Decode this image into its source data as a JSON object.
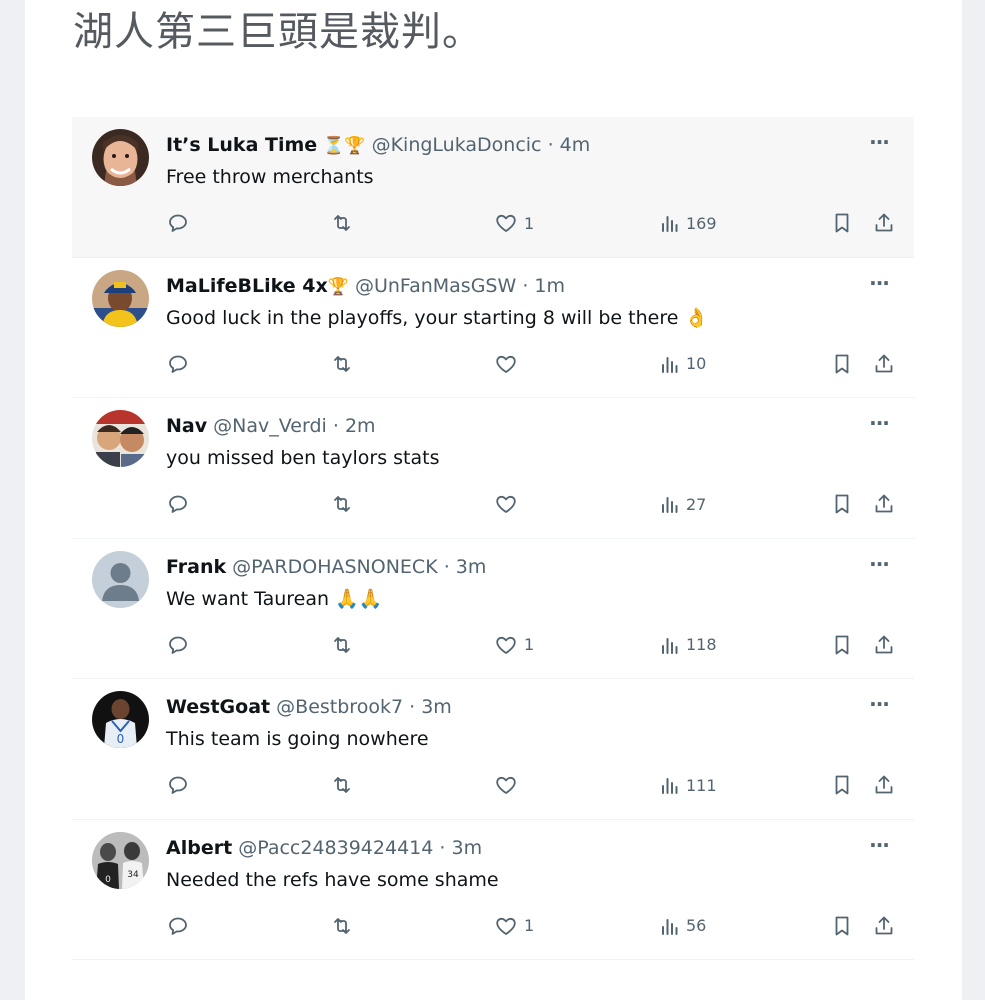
{
  "post": {
    "title": "湖人第三巨頭是裁判。"
  },
  "colors": {
    "icon_gray": "#536471",
    "text": "#0f1419",
    "highlight_bg": "#f7f7f7"
  },
  "tweets": [
    {
      "name": "It’s Luka Time",
      "badges": "⏳🏆",
      "handle": "@KingLukaDoncic",
      "sep": "·",
      "time": "4m",
      "text": "Free throw merchants",
      "likes": "1",
      "views": "169",
      "highlighted": true,
      "avatar": "smiling-man"
    },
    {
      "name": "MaLifeBLike 4x",
      "badges": "🏆",
      "handle": "@UnFanMasGSW",
      "sep": "·",
      "time": "1m",
      "text": "Good luck in the playoffs, your starting 8 will be there 👌",
      "likes": "",
      "views": "10",
      "highlighted": false,
      "avatar": "cap-player"
    },
    {
      "name": "Nav",
      "badges": "",
      "handle": "@Nav_Verdi",
      "sep": "·",
      "time": "2m",
      "text": "you missed ben taylors stats",
      "likes": "",
      "views": "27",
      "highlighted": false,
      "avatar": "cartoon-pair"
    },
    {
      "name": "Frank",
      "badges": "",
      "handle": "@PARDOHASNONECK",
      "sep": "·",
      "time": "3m",
      "text": "We want Taurean 🙏🙏",
      "likes": "1",
      "views": "118",
      "highlighted": false,
      "avatar": "default-user"
    },
    {
      "name": "WestGoat",
      "badges": "",
      "handle": "@Bestbrook7",
      "sep": "·",
      "time": "3m",
      "text": "This team is going nowhere",
      "likes": "",
      "views": "111",
      "highlighted": false,
      "avatar": "jersey-player"
    },
    {
      "name": "Albert",
      "badges": "",
      "handle": "@Pacc24839424414",
      "sep": "·",
      "time": "3m",
      "text": "Needed the refs have some shame",
      "likes": "1",
      "views": "56",
      "highlighted": false,
      "avatar": "bw-players"
    }
  ]
}
